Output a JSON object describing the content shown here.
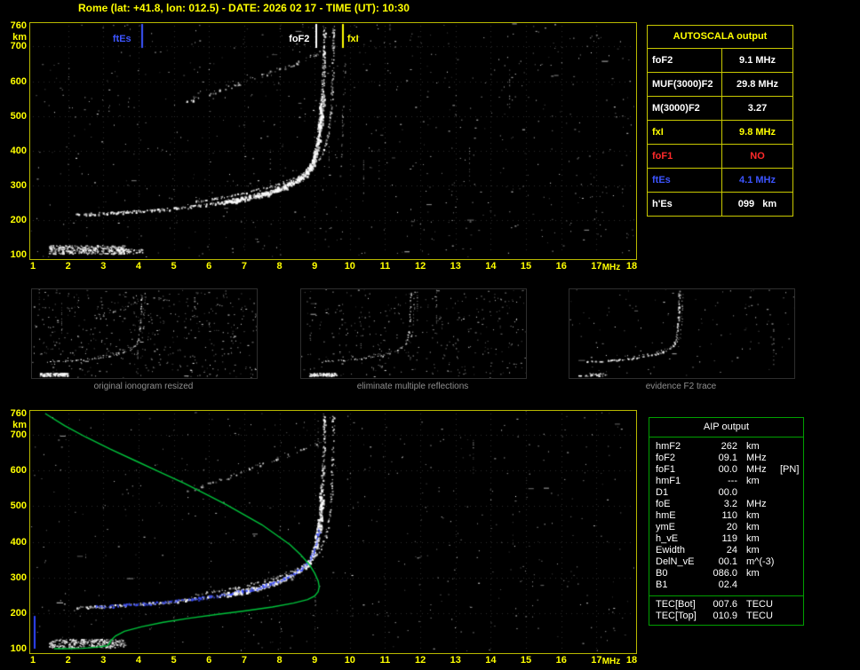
{
  "window": {
    "title": "Rome (lat: +41.8, lon: 012.5) - DATE: 2026 02 17 - TIME (UT): 10:30"
  },
  "axes": {
    "x_ticks": [
      "1",
      "2",
      "3",
      "4",
      "5",
      "6",
      "7",
      "8",
      "9",
      "10",
      "11",
      "12",
      "13",
      "14",
      "15",
      "16",
      "17",
      "18"
    ],
    "x_unit": "MHz",
    "y_ticks": [
      "760",
      "700",
      "600",
      "500",
      "400",
      "300",
      "200",
      "100"
    ],
    "y_unit": "km",
    "f_min": 1,
    "f_max": 18,
    "h_min": 100,
    "h_max": 760
  },
  "markers": [
    {
      "label": "ftEs",
      "freq": 4.1,
      "color": "#3c54ff",
      "label_dx": -33
    },
    {
      "label": "foF2",
      "freq": 9.05,
      "color": "#ffffff",
      "label_dx": -31
    },
    {
      "label": "fxI",
      "freq": 9.8,
      "color": "#ffff00",
      "label_dx": 5
    }
  ],
  "autoscala": {
    "title": "AUTOSCALA output",
    "rows": [
      {
        "label": "foF2",
        "value": "9.1 MHz",
        "color": "#ffffff"
      },
      {
        "label": "MUF(3000)F2",
        "value": "29.8 MHz",
        "color": "#ffffff"
      },
      {
        "label": "M(3000)F2",
        "value": "3.27",
        "color": "#ffffff"
      },
      {
        "label": "fxI",
        "value": "9.8 MHz",
        "color": "#ffff00"
      },
      {
        "label": "foF1",
        "value": "NO",
        "color": "#ff2a2a"
      },
      {
        "label": "ftEs",
        "value": "4.1 MHz",
        "color": "#3c54ff"
      },
      {
        "label": "h'Es",
        "value": "099   km",
        "color": "#ffffff"
      }
    ]
  },
  "thumbnails": [
    {
      "caption": "original ionogram resized"
    },
    {
      "caption": "eliminate multiple reflections"
    },
    {
      "caption": "evidence F2 trace"
    }
  ],
  "aip": {
    "title": "AIP output",
    "rows": [
      {
        "label": "hmF2",
        "value": "262",
        "unit": "km",
        "note": ""
      },
      {
        "label": "foF2",
        "value": "09.1",
        "unit": "MHz",
        "note": ""
      },
      {
        "label": "foF1",
        "value": "00.0",
        "unit": "MHz",
        "note": "[PN]"
      },
      {
        "label": "hmF1",
        "value": "---",
        "unit": "km",
        "note": ""
      },
      {
        "label": "D1",
        "value": "00.0",
        "unit": "",
        "note": ""
      },
      {
        "label": "foE",
        "value": "3.2",
        "unit": "MHz",
        "note": ""
      },
      {
        "label": "hmE",
        "value": "110",
        "unit": "km",
        "note": ""
      },
      {
        "label": "ymE",
        "value": "20",
        "unit": "km",
        "note": ""
      },
      {
        "label": "h_vE",
        "value": "119",
        "unit": "km",
        "note": ""
      },
      {
        "label": "Ewidth",
        "value": "24",
        "unit": "km",
        "note": ""
      },
      {
        "label": "DelN_vE",
        "value": "00.1",
        "unit": "m^(-3)",
        "note": ""
      },
      {
        "label": "B0",
        "value": "086.0",
        "unit": "km",
        "note": ""
      },
      {
        "label": "B1",
        "value": "02.4",
        "unit": "",
        "note": ""
      }
    ],
    "tec_rows": [
      {
        "label": "TEC[Bot]",
        "value": "007.6",
        "unit": "TECU"
      },
      {
        "label": "TEC[Top]",
        "value": "010.9",
        "unit": "TECU"
      }
    ]
  },
  "chart_data": {
    "type": "scatter",
    "title": "Ionogram with AUTOSCALA interpretation",
    "xlabel": "MHz",
    "ylabel": "km",
    "xlim": [
      1,
      18
    ],
    "ylim": [
      100,
      760
    ],
    "f2_o_trace": [
      [
        2.2,
        216
      ],
      [
        2.8,
        219
      ],
      [
        3.4,
        222
      ],
      [
        4.0,
        226
      ],
      [
        4.6,
        230
      ],
      [
        5.2,
        236
      ],
      [
        5.8,
        243
      ],
      [
        6.4,
        252
      ],
      [
        7.0,
        263
      ],
      [
        7.5,
        275
      ],
      [
        8.0,
        291
      ],
      [
        8.4,
        310
      ],
      [
        8.7,
        332
      ],
      [
        8.9,
        358
      ],
      [
        9.02,
        392
      ],
      [
        9.1,
        435
      ],
      [
        9.16,
        490
      ],
      [
        9.2,
        555
      ],
      [
        9.24,
        630
      ],
      [
        9.27,
        760
      ]
    ],
    "f2_x_trace": [
      [
        5.6,
        254
      ],
      [
        6.2,
        263
      ],
      [
        6.8,
        274
      ],
      [
        7.4,
        288
      ],
      [
        8.0,
        305
      ],
      [
        8.5,
        325
      ],
      [
        8.9,
        350
      ],
      [
        9.15,
        380
      ],
      [
        9.32,
        420
      ],
      [
        9.42,
        475
      ],
      [
        9.47,
        545
      ],
      [
        9.5,
        630
      ],
      [
        9.52,
        760
      ]
    ],
    "second_hop_trace": [
      [
        5.3,
        540
      ],
      [
        5.9,
        560
      ],
      [
        6.5,
        582
      ],
      [
        7.1,
        604
      ],
      [
        7.7,
        626
      ],
      [
        8.3,
        648
      ],
      [
        8.8,
        668
      ],
      [
        9.15,
        684
      ]
    ],
    "fx_tail": [
      [
        9.72,
        320
      ],
      [
        9.78,
        420
      ],
      [
        9.82,
        540
      ],
      [
        9.84,
        680
      ]
    ],
    "es_layer": {
      "f_min": 1.45,
      "f_max": 3.6,
      "h_min": 103,
      "h_max": 128
    },
    "profile": [
      [
        1.35,
        760
      ],
      [
        1.9,
        726
      ],
      [
        2.5,
        694
      ],
      [
        3.2,
        660
      ],
      [
        3.9,
        628
      ],
      [
        4.6,
        596
      ],
      [
        5.3,
        564
      ],
      [
        5.9,
        534
      ],
      [
        6.5,
        504
      ],
      [
        7.0,
        476
      ],
      [
        7.5,
        448
      ],
      [
        7.9,
        420
      ],
      [
        8.3,
        392
      ],
      [
        8.6,
        364
      ],
      [
        8.85,
        336
      ],
      [
        9.0,
        312
      ],
      [
        9.1,
        290
      ],
      [
        9.13,
        274
      ],
      [
        9.1,
        260
      ],
      [
        9.0,
        248
      ],
      [
        8.8,
        238
      ],
      [
        8.4,
        228
      ],
      [
        7.8,
        217
      ],
      [
        7.0,
        206
      ],
      [
        6.2,
        196
      ],
      [
        5.4,
        185
      ],
      [
        4.7,
        174
      ],
      [
        4.1,
        162
      ],
      [
        3.6,
        149
      ],
      [
        3.35,
        136
      ],
      [
        3.22,
        124
      ],
      [
        3.18,
        114
      ],
      [
        3.1,
        108
      ],
      [
        2.8,
        104
      ],
      [
        2.4,
        101
      ],
      [
        1.9,
        100
      ],
      [
        1.6,
        100
      ]
    ],
    "key_values": {
      "foF2_MHz": 9.1,
      "fxI_MHz": 9.8,
      "ftEs_MHz": 4.1,
      "hEs_km": 99,
      "hmF2_km": 262,
      "foE_MHz": 3.2
    }
  }
}
